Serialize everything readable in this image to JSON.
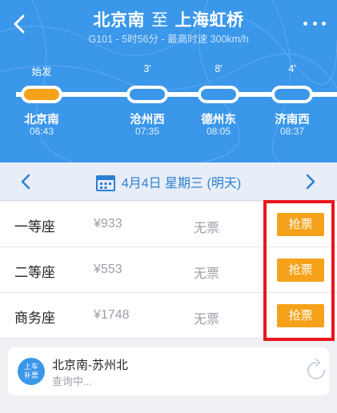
{
  "header": {
    "from": "北京南",
    "separator": "至",
    "to": "上海虹桥",
    "subtitle": "G101 - 5时56分 - 最高时速 300km/h",
    "bg_color": "#3a97ea"
  },
  "route": {
    "stops": [
      {
        "top_label": "始发",
        "name": "北京南",
        "time": "06:43"
      },
      {
        "top_label": "3'",
        "name": "沧州西",
        "time": "07:35"
      },
      {
        "top_label": "8'",
        "name": "德州东",
        "time": "08:05"
      },
      {
        "top_label": "4'",
        "name": "济南西",
        "time": "08:37"
      }
    ]
  },
  "date_bar": {
    "date_text": "4月4日 星期三 (明天)"
  },
  "seats": [
    {
      "name": "一等座",
      "price": "¥933",
      "status": "无票",
      "button": "抢票"
    },
    {
      "name": "二等座",
      "price": "¥553",
      "status": "无票",
      "button": "抢票"
    },
    {
      "name": "商务座",
      "price": "¥1748",
      "status": "无票",
      "button": "抢票"
    }
  ],
  "transfer_card": {
    "badge_line1": "上车",
    "badge_line2": "补票",
    "route": "北京南-苏州北",
    "status": "查询中..."
  },
  "colors": {
    "accent_orange": "#f5a21a",
    "highlight_red": "#e8161e",
    "link_blue": "#2d7fd4"
  }
}
